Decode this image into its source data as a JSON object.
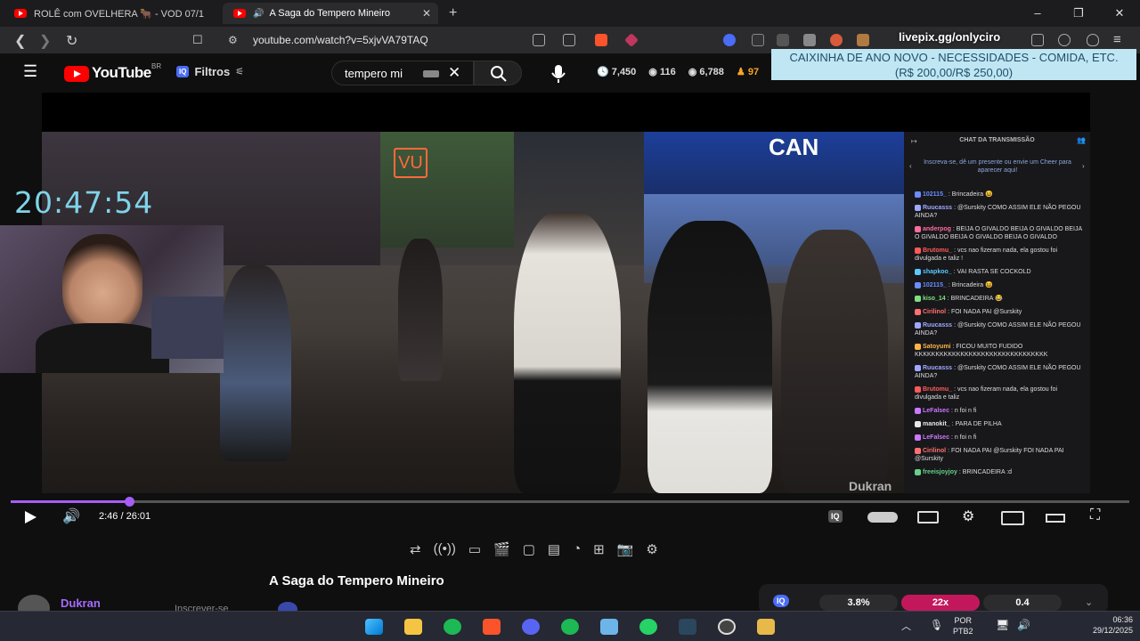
{
  "tabs": [
    {
      "label": "ROLÊ com OVELHERA 🐂 - VOD 07/1",
      "active": false
    },
    {
      "label": "A Saga do Tempero Mineiro",
      "active": true
    }
  ],
  "window_controls": {
    "minimize": "–",
    "restore": "❐",
    "close": "✕"
  },
  "address": {
    "url": "youtube.com/watch?v=5xjvVA79TAQ",
    "back": "❮",
    "forward": "❯",
    "reload": "↻",
    "bookmark": "🔖"
  },
  "overlay": {
    "livepix": "livepix.gg/onlyciro",
    "banner_line1": "CAIXINHA DE ANO NOVO - NECESSIDADES - COMIDA, ETC.",
    "banner_line2": "(R$ 200,00/R$ 250,00)",
    "clock": "20:47:54"
  },
  "youtube": {
    "logo": "YouTube",
    "region": "BR",
    "filters_label": "Filtros",
    "search_value": "tempero mi",
    "stats": [
      {
        "icon": "clock-icon",
        "value": "7,450"
      },
      {
        "icon": "eye-icon",
        "value": "116"
      },
      {
        "icon": "eye-icon",
        "value": "6,788"
      },
      {
        "icon": "user-icon",
        "value": "97"
      }
    ]
  },
  "chat": {
    "title": "CHAT DA TRANSMISSÃO",
    "subtitle": "Inscreva-se, dê um presente ou envie um Cheer para aparecer aqui!",
    "messages": [
      {
        "user": "102115_",
        "color": "#6c8cff",
        "text": ": Brincadeira 😆"
      },
      {
        "user": "Ruucasss",
        "color": "#9fa8ff",
        "text": ": @Surskity COMO ASSIM ELE NÃO PEGOU AINDA?"
      },
      {
        "user": "anderpog",
        "color": "#ff6b9a",
        "text": ": BEIJA O GIVALDO BEIJA O GIVALDO BEIJA O GIVALDO BEIJA O GIVALDO BEIJA O GIVALDO"
      },
      {
        "user": "Brutomu_",
        "color": "#ff5a5a",
        "text": ": vcs nao fizeram nada, ela gostou foi divulgada e taliz !"
      },
      {
        "user": "shapkoo_",
        "color": "#5ac8ff",
        "text": ": VAI RASTA SE COCKOLD"
      },
      {
        "user": "102115_",
        "color": "#6c8cff",
        "text": ": Brincadeira 😆"
      },
      {
        "user": "kiso_14",
        "color": "#7ee07e",
        "text": ": BRINCADEIRA 😂"
      },
      {
        "user": "Cirilinol",
        "color": "#ff7070",
        "text": ": FOI NADA PAI @Surskity"
      },
      {
        "user": "Ruucasss",
        "color": "#9fa8ff",
        "text": ": @Surskity COMO ASSIM ELE NÃO PEGOU AINDA?"
      },
      {
        "user": "Satoyumi",
        "color": "#ffb347",
        "text": ": FICOU MUITO FUDIDO KKKKKKKKKKKKKKKKKKKKKKKKKKKKKKKK"
      },
      {
        "user": "Ruucasss",
        "color": "#9fa8ff",
        "text": ": @Surskity COMO ASSIM ELE NÃO PEGOU AINDA?"
      },
      {
        "user": "Brutomu_",
        "color": "#ff5a5a",
        "text": ": vcs nao fizeram nada, ela gostou foi divulgada e taliz"
      },
      {
        "user": "LeFalsec",
        "color": "#c978ff",
        "text": ": n foi n fi"
      },
      {
        "user": "manokit_",
        "color": "#e8e8e8",
        "text": ": PARA DE PILHA"
      },
      {
        "user": "LeFalsec",
        "color": "#c978ff",
        "text": ": n foi n fi"
      },
      {
        "user": "Cirilinol",
        "color": "#ff7070",
        "text": ": FOI NADA PAI @Surskity FOI NADA PAI @Surskity"
      },
      {
        "user": "freeisjoyjoy",
        "color": "#66d18a",
        "text": ": BRINCADEIRA :d"
      }
    ]
  },
  "video": {
    "watermark": "Dukran",
    "sign_text": "CAN",
    "progress_fraction": 0.106,
    "time": "2:46 / 26:01"
  },
  "below": {
    "title": "A Saga do Tempero Mineiro",
    "channel": "Dukran",
    "subscribe": "Inscrever-se",
    "metrics": [
      "3.8%",
      "22x",
      "0.4"
    ]
  },
  "taskbar": {
    "lang_top": "POR",
    "lang_bottom": "PTB2",
    "time": "06:36",
    "date": "29/12/2025"
  }
}
